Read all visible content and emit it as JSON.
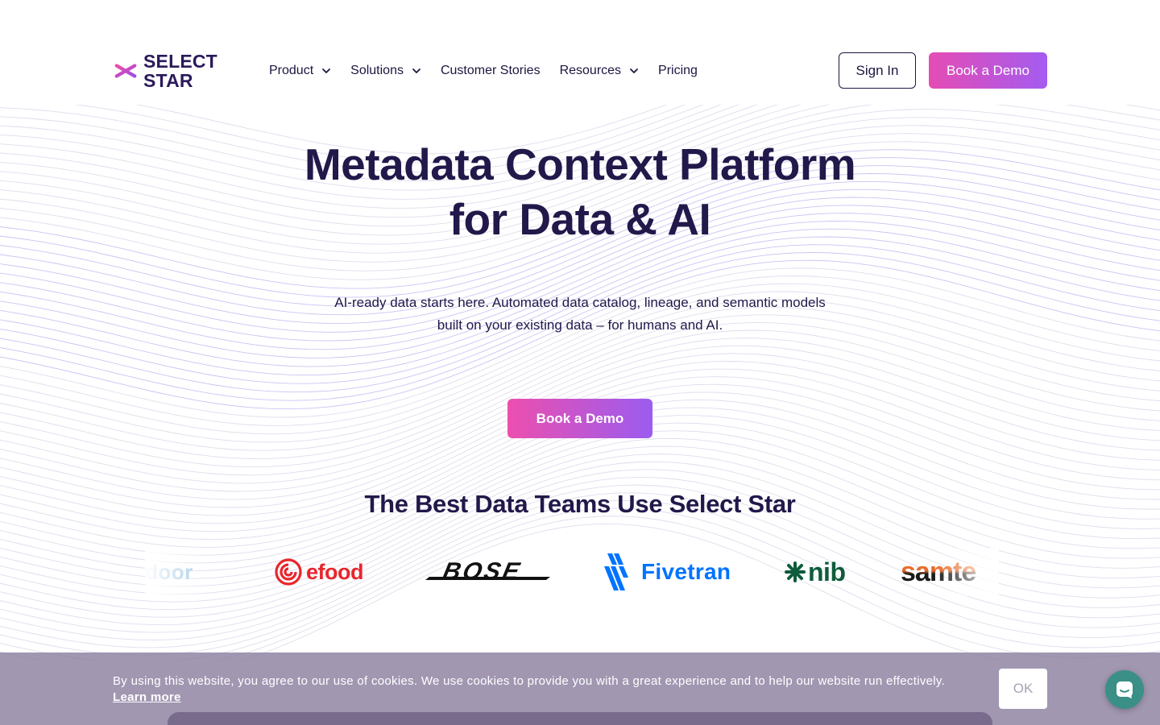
{
  "brand": {
    "line1": "SELECT",
    "line2": "STAR"
  },
  "nav": {
    "items": [
      {
        "label": "Product",
        "has_dropdown": true
      },
      {
        "label": "Solutions",
        "has_dropdown": true
      },
      {
        "label": "Customer Stories",
        "has_dropdown": false
      },
      {
        "label": "Resources",
        "has_dropdown": true
      },
      {
        "label": "Pricing",
        "has_dropdown": false
      }
    ],
    "sign_in": "Sign In",
    "book_demo": "Book a Demo"
  },
  "hero": {
    "title_line1": "Metadata Context Platform",
    "title_line2": "for Data & AI",
    "subtitle_line1": "AI-ready data starts here. Automated data catalog, lineage, and semantic models",
    "subtitle_line2": "built on your existing data – for humans and AI.",
    "cta": "Book a Demo"
  },
  "customers": {
    "heading": "The Best Data Teams Use Select Star",
    "logos": [
      "door",
      "efood",
      "BOSE",
      "Fivetran",
      "nib",
      "samte"
    ]
  },
  "cookie_banner": {
    "text": "By using this website, you agree to our use of cookies. We use cookies to provide you with a great experience and to help our website run effectively.",
    "link": "Learn more",
    "ok": "OK"
  },
  "colors": {
    "text_dark": "#22184a",
    "cta_gradient_start": "#ec4fae",
    "cta_gradient_end": "#9b5cf0",
    "efood_red": "#e8262d",
    "fivetran_blue": "#0073ff",
    "nib_green": "#0e5c3b",
    "samtec_orange": "#e8692b",
    "chat_teal": "#3a8f86"
  },
  "icons": {
    "logo": "asterisk-star-icon",
    "dropdown": "chevron-down-icon",
    "chat": "chat-bubble-icon"
  }
}
